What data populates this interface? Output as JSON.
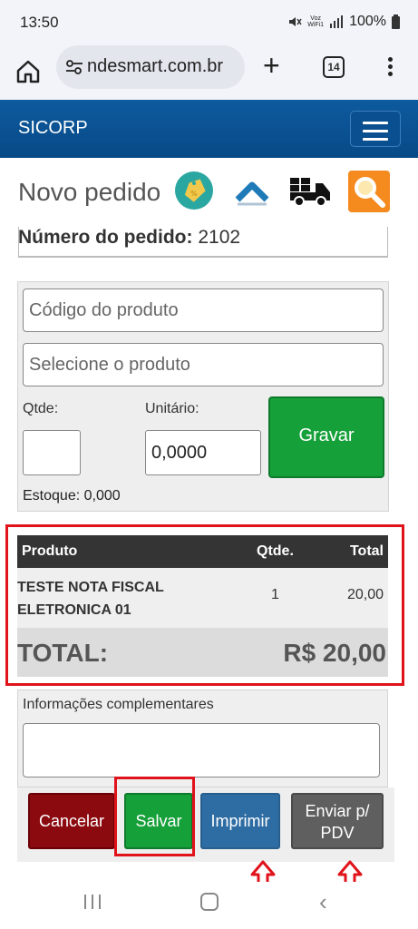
{
  "status_bar": {
    "time": "13:50",
    "network": "Voz WiFi1",
    "battery": "100%"
  },
  "browser": {
    "url": "ndesmart.com.br",
    "tab_count": "14",
    "icons": [
      "home-icon",
      "site-settings-icon",
      "new-tab-icon",
      "tabs-icon",
      "more-menu-icon"
    ]
  },
  "navbar": {
    "brand": "SICORP",
    "color": "#0b5394"
  },
  "page": {
    "title": "Novo pedido",
    "order_label": "Número do pedido:",
    "order_number": "2102",
    "header_icons": [
      "price-tag-icon",
      "up-arrow-icon",
      "truck-icon",
      "search-icon"
    ]
  },
  "product_form": {
    "code_placeholder": "Código do produto",
    "select_placeholder": "Selecione o produto",
    "qty_label": "Qtde:",
    "unit_label": "Unitário:",
    "qty_value": "",
    "unit_value": "0,0000",
    "save_item_button": "Gravar",
    "stock": "Estoque: 0,000"
  },
  "table": {
    "columns": [
      "Produto",
      "Qtde.",
      "Total"
    ],
    "rows": [
      {
        "product": "TESTE NOTA FISCAL ELETRONICA 01",
        "qty": "1",
        "total": "20,00"
      }
    ],
    "total_label": "TOTAL:",
    "total_value": "R$ 20,00"
  },
  "info": {
    "label": "Informações complementares",
    "value": ""
  },
  "actions": {
    "cancel": "Cancelar",
    "save": "Salvar",
    "print": "Imprimir",
    "send_line1": "Enviar p/",
    "send_line2": "PDV"
  },
  "colors": {
    "highlight": "#e0131b",
    "green": "#16a03a",
    "red": "#8b0a10",
    "blue": "#2e6da4",
    "gray": "#5f5f5f"
  }
}
